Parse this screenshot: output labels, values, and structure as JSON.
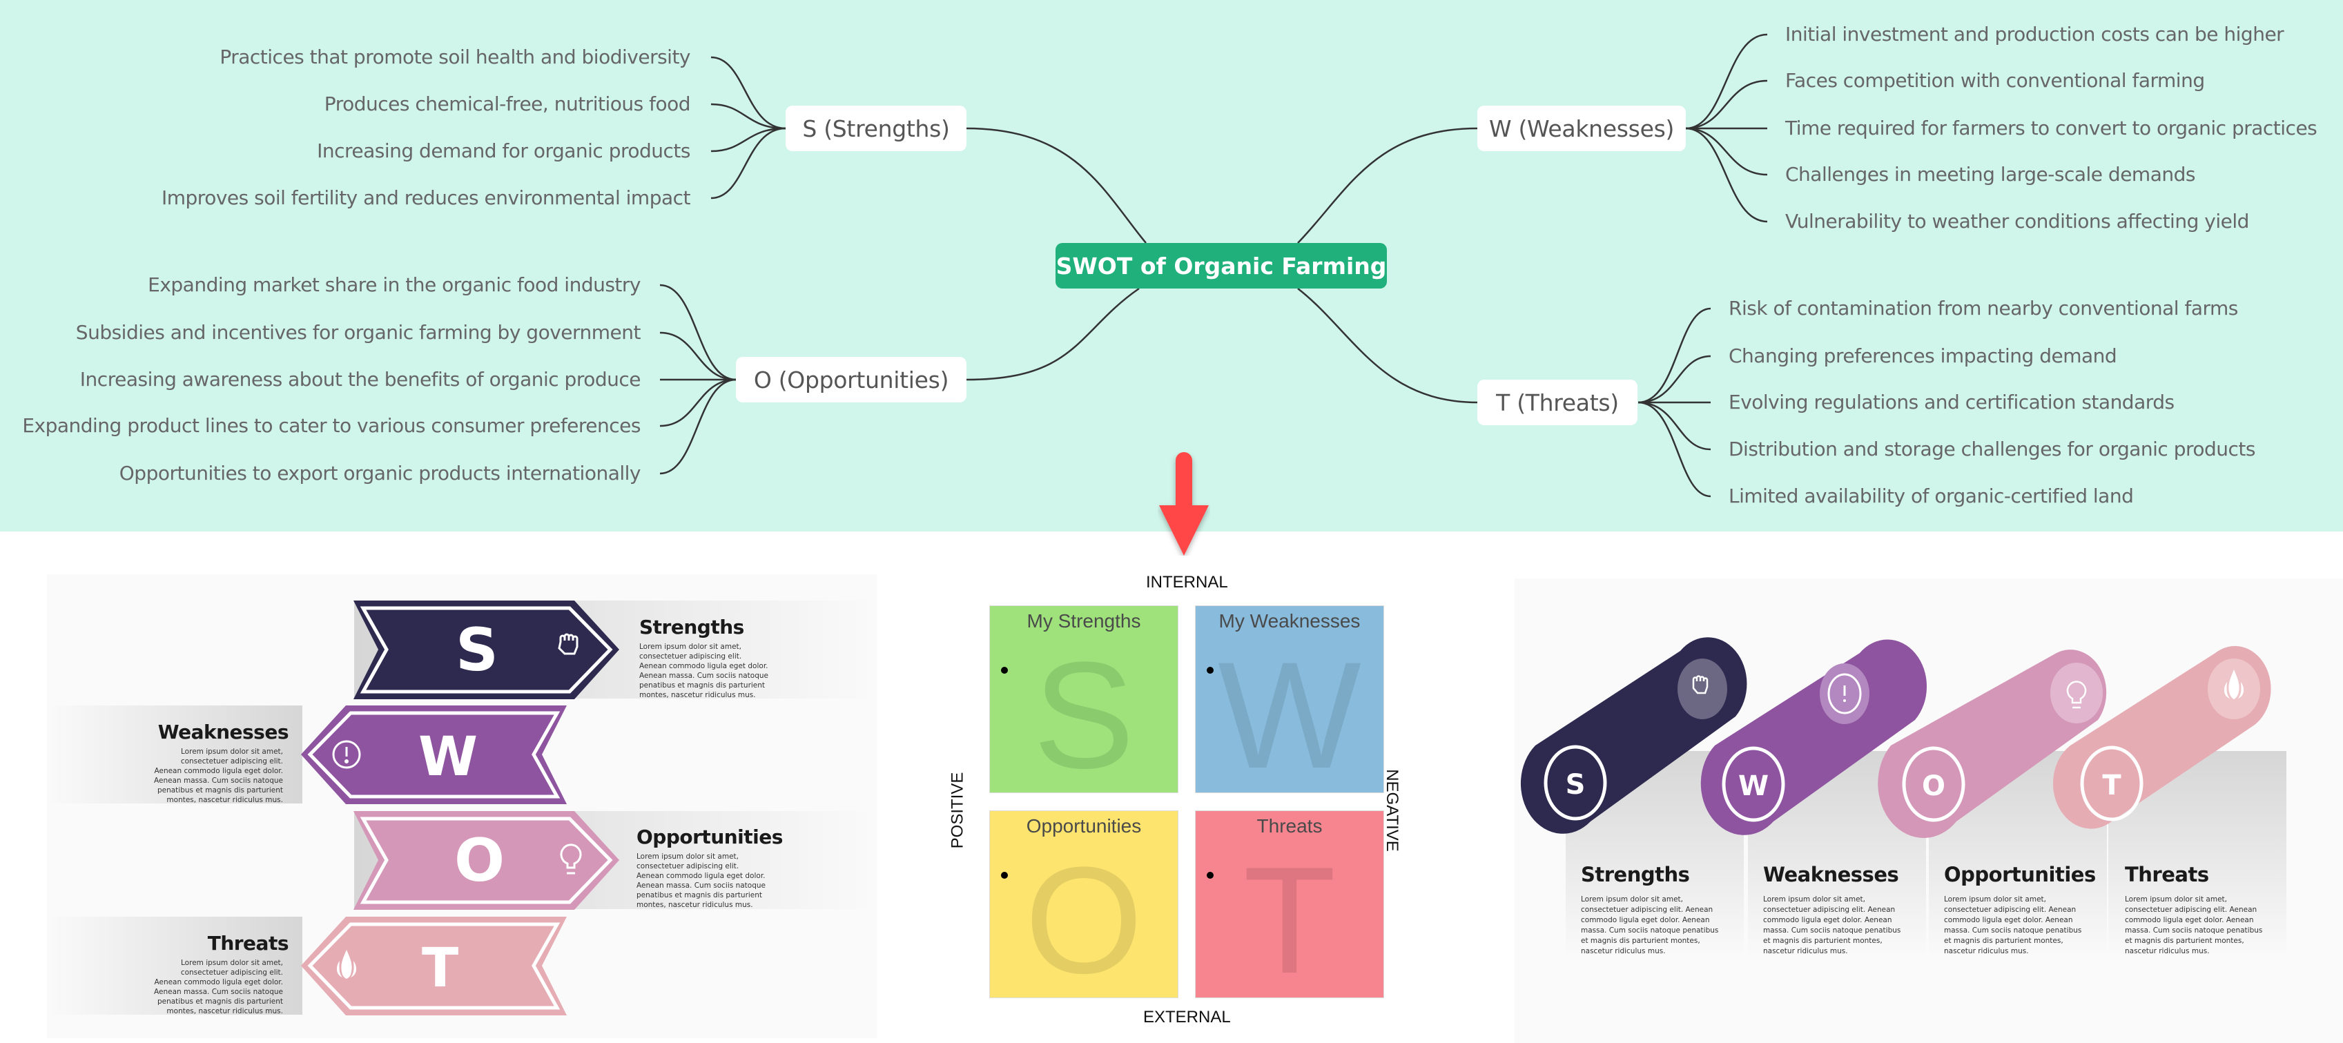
{
  "mindmap": {
    "root": "SWOT of Organic Farming",
    "branches": {
      "strengths": {
        "label": "S (Strengths)",
        "items": [
          "Practices that promote soil health and biodiversity",
          "Produces chemical-free, nutritious food",
          "Increasing demand for organic products",
          "Improves soil fertility and reduces environmental impact"
        ]
      },
      "weaknesses": {
        "label": "W (Weaknesses)",
        "items": [
          "Initial investment and production costs can be higher",
          "Faces competition with conventional farming",
          "Time required for farmers to convert to organic practices",
          "Challenges in meeting large-scale demands",
          "Vulnerability to weather conditions affecting yield"
        ]
      },
      "opportunities": {
        "label": "O (Opportunities)",
        "items": [
          "Expanding market share in the organic food industry",
          "Subsidies and incentives for organic farming by government",
          "Increasing awareness about the benefits of organic produce",
          "Expanding product lines to cater to various consumer preferences",
          "Opportunities to export organic products internationally"
        ]
      },
      "threats": {
        "label": "T (Threats)",
        "items": [
          "Risk of contamination from nearby conventional farms",
          "Changing preferences impacting demand",
          "Evolving regulations and certification standards",
          "Distribution and storage challenges for organic products",
          "Limited availability of organic-certified land"
        ]
      }
    },
    "colors": {
      "background": "#d0f5ea",
      "root": "#20b07c",
      "arrow": "#ff4646"
    }
  },
  "template_chevrons": {
    "items": [
      {
        "letter": "S",
        "title": "Strengths",
        "icon": "fist-icon",
        "color": "#2e294e",
        "body": "Lorem ipsum dolor sit amet, consectetuer adipiscing elit. Aenean commodo ligula eget dolor. Aenean massa. Cum sociis natoque penatibus et magnis dis parturient montes, nascetur ridiculus mus."
      },
      {
        "letter": "W",
        "title": "Weaknesses",
        "icon": "alert-icon",
        "color": "#8e54a0",
        "body": "Lorem ipsum dolor sit amet, consectetuer adipiscing elit. Aenean commodo ligula eget dolor. Aenean massa. Cum sociis natoque penatibus et magnis dis parturient montes, nascetur ridiculus mus."
      },
      {
        "letter": "O",
        "title": "Opportunities",
        "icon": "lightbulb-icon",
        "color": "#d497b7",
        "body": "Lorem ipsum dolor sit amet, consectetuer adipiscing elit. Aenean commodo ligula eget dolor. Aenean massa. Cum sociis natoque penatibus et magnis dis parturient montes, nascetur ridiculus mus."
      },
      {
        "letter": "T",
        "title": "Threats",
        "icon": "flame-icon",
        "color": "#e6acb4",
        "body": "Lorem ipsum dolor sit amet, consectetuer adipiscing elit. Aenean commodo ligula eget dolor. Aenean massa. Cum sociis natoque penatibus et magnis dis parturient montes, nascetur ridiculus mus."
      }
    ]
  },
  "template_grid": {
    "axes": {
      "top": "INTERNAL",
      "bottom": "EXTERNAL",
      "left": "POSITIVE",
      "right": "NEGATIVE"
    },
    "quadrants": [
      {
        "title": "My Strengths",
        "letter": "S",
        "bg": "#9fe27c",
        "letter_color": "#8acb6e"
      },
      {
        "title": "My Weaknesses",
        "letter": "W",
        "bg": "#89bbdc",
        "letter_color": "#7aaac6"
      },
      {
        "title": "Opportunities",
        "letter": "O",
        "bg": "#fde46e",
        "letter_color": "#e4cd62"
      },
      {
        "title": "Threats",
        "letter": "T",
        "bg": "#f6858f",
        "letter_color": "#de7681"
      }
    ]
  },
  "template_tubes": {
    "items": [
      {
        "letter": "S",
        "title": "Strengths",
        "icon": "fist-icon",
        "color": "#2e294e",
        "icon_bg": "#6c6883",
        "body": "Lorem ipsum dolor sit amet, consectetuer adipiscing elit. Aenean commodo ligula eget dolor. Aenean massa. Cum sociis natoque penatibus et magnis dis parturient montes, nascetur ridiculus mus."
      },
      {
        "letter": "W",
        "title": "Weaknesses",
        "icon": "alert-icon",
        "color": "#8e54a0",
        "icon_bg": "#b387bf",
        "body": "Lorem ipsum dolor sit amet, consectetuer adipiscing elit. Aenean commodo ligula eget dolor. Aenean massa. Cum sociis natoque penatibus et magnis dis parturient montes, nascetur ridiculus mus."
      },
      {
        "letter": "O",
        "title": "Opportunities",
        "icon": "lightbulb-icon",
        "color": "#d497b7",
        "icon_bg": "#e2b6cf",
        "body": "Lorem ipsum dolor sit amet, consectetuer adipiscing elit. Aenean commodo ligula eget dolor. Aenean massa. Cum sociis natoque penatibus et magnis dis parturient montes, nascetur ridiculus mus."
      },
      {
        "letter": "T",
        "title": "Threats",
        "icon": "flame-icon",
        "color": "#e6acb4",
        "icon_bg": "#eec6ca",
        "body": "Lorem ipsum dolor sit amet, consectetuer adipiscing elit. Aenean commodo ligula eget dolor. Aenean massa. Cum sociis natoque penatibus et magnis dis parturient montes, nascetur ridiculus mus."
      }
    ]
  }
}
